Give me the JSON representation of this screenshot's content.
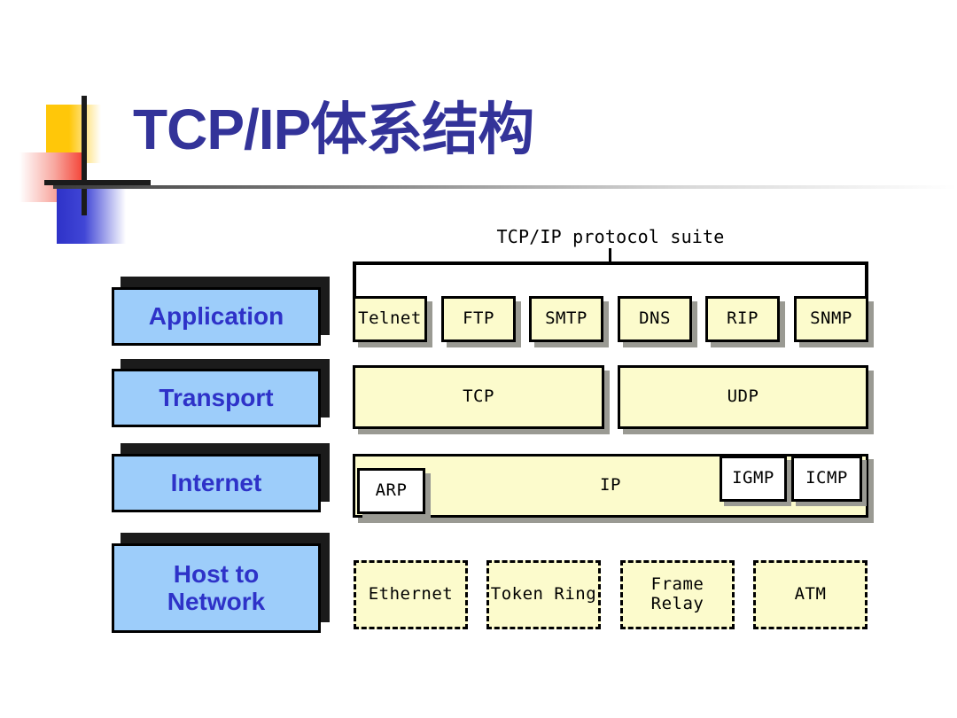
{
  "slide": {
    "title": "TCP/IP体系结构",
    "title_color": "#333399",
    "background": "#ffffff",
    "logo": {
      "square_yellow": "#FFC709",
      "square_red": "#F44336",
      "square_blue": "#2E32C8",
      "cross": "#1b1b1b"
    }
  },
  "diagram": {
    "suite_label": "TCP/IP protocol suite",
    "layer_box_color": "#9DCDFA",
    "layer_text_color": "#2E32C8",
    "protocol_box_color": "#FCFBCC",
    "layers": [
      {
        "label": "Application"
      },
      {
        "label": "Transport"
      },
      {
        "label": "Internet"
      },
      {
        "label": "Host to\nNetwork",
        "line1": "Host to",
        "line2": "Network"
      }
    ],
    "application_protocols": [
      {
        "label": "Telnet"
      },
      {
        "label": "FTP"
      },
      {
        "label": "SMTP"
      },
      {
        "label": "DNS"
      },
      {
        "label": "RIP"
      },
      {
        "label": "SNMP"
      }
    ],
    "transport_protocols": [
      {
        "label": "TCP"
      },
      {
        "label": "UDP"
      }
    ],
    "internet_protocols": [
      {
        "label": "IP"
      },
      {
        "label": "ARP"
      },
      {
        "label": "IGMP"
      },
      {
        "label": "ICMP"
      }
    ],
    "host_network_protocols": [
      {
        "label": "Ethernet"
      },
      {
        "label": "Token Ring"
      },
      {
        "line1": "Frame",
        "line2": "Relay"
      },
      {
        "label": "ATM"
      }
    ]
  }
}
